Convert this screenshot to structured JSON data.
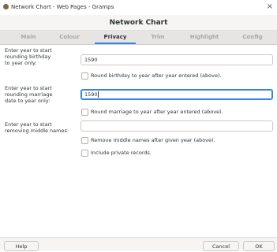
{
  "window": {
    "title": "Network Chart - Web Pages - Gramps"
  },
  "dialog": {
    "title": "Network Chart"
  },
  "tabs": [
    "Main",
    "Colour",
    "Privacy",
    "Trim",
    "Highlight",
    "Config"
  ],
  "active_tab": "Privacy",
  "privacy": {
    "birthday_label": [
      "Enter year to start",
      "rounding birthday",
      "to year only:"
    ],
    "birthday_year": "1590",
    "round_birthday_label": "Round birthday to year after year entered (above).",
    "marriage_label": [
      "Enter year to start",
      "rounding marriage",
      "date to year only:"
    ],
    "marriage_year": "1590",
    "round_marriage_label": "Round marriage to year after year entered (above).",
    "middle_label": [
      "Enter year to start",
      "removing middle names:"
    ],
    "middle_year": "",
    "remove_middle_label": "Remove middle names after given year (above).",
    "include_private_label": "Include private records."
  },
  "buttons": {
    "help": "Help",
    "cancel": "Cancel",
    "ok": "OK"
  }
}
